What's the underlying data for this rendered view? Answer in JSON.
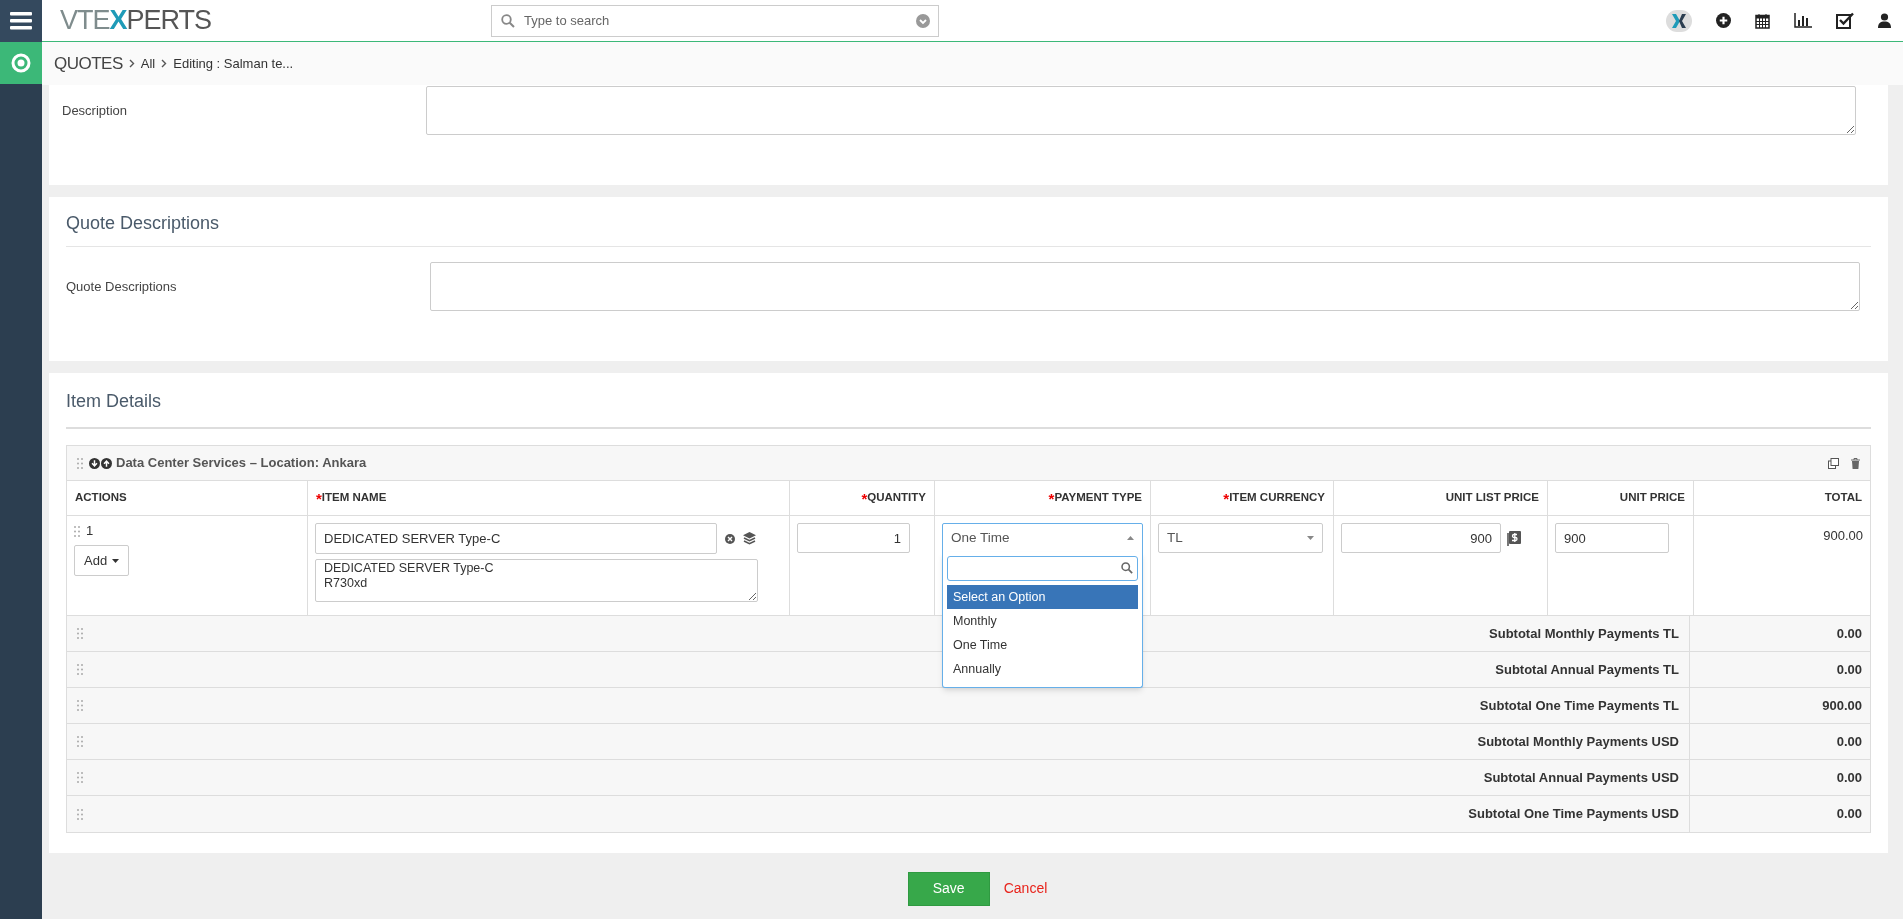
{
  "topbar": {
    "logo": {
      "before": "VTE",
      "accent": "X",
      "after": "PERTS"
    },
    "search": {
      "placeholder": "Type to search"
    }
  },
  "breadcrumb": [
    "QUOTES",
    "All",
    "Editing : Salman te..."
  ],
  "description_block": {
    "fields": [
      {
        "label": "Description"
      }
    ]
  },
  "quote_descriptions": {
    "title": "Quote Descriptions",
    "fields": [
      {
        "label": "Quote Descriptions"
      }
    ]
  },
  "item_details": {
    "title": "Item Details",
    "block_title": "Data Center Services – Location: Ankara",
    "columns": [
      {
        "label": "ACTIONS"
      },
      {
        "label": "ITEM NAME",
        "marker": "*"
      },
      {
        "label": "QUANTITY",
        "marker": "*"
      },
      {
        "label": "PAYMENT TYPE",
        "marker": "*"
      },
      {
        "label": "ITEM CURRENCY",
        "marker": "*"
      },
      {
        "label": "UNIT LIST PRICE"
      },
      {
        "label": "UNIT PRICE"
      },
      {
        "label": "TOTAL"
      }
    ],
    "rows": [
      {
        "number": "1",
        "add_button": "Add",
        "item_name": "DEDICATED SERVER Type-C",
        "item_description": "DEDICATED SERVER Type-C\nR730xd",
        "quantity": "1",
        "payment_type": "One Time",
        "currency": "TL",
        "unit_list_price": "900",
        "unit_price": "900",
        "total": "900.00"
      }
    ],
    "payment_dropdown": {
      "options": [
        {
          "label": "Select an Option",
          "selected": true
        },
        {
          "label": "Monthly",
          "selected": false
        },
        {
          "label": "One Time",
          "selected": false
        },
        {
          "label": "Annually",
          "selected": false
        }
      ]
    },
    "subtotals": [
      {
        "label": "Subtotal Monthly Payments TL",
        "value": "0.00"
      },
      {
        "label": "Subtotal Annual Payments TL",
        "value": "0.00"
      },
      {
        "label": "Subtotal One Time Payments TL",
        "value": "900.00"
      },
      {
        "label": "Subtotal Monthly Payments USD",
        "value": "0.00"
      },
      {
        "label": "Subtotal Annual Payments USD",
        "value": "0.00"
      },
      {
        "label": "Subtotal One Time Payments USD",
        "value": "0.00"
      }
    ]
  },
  "footer": {
    "save": "Save",
    "cancel": "Cancel"
  }
}
